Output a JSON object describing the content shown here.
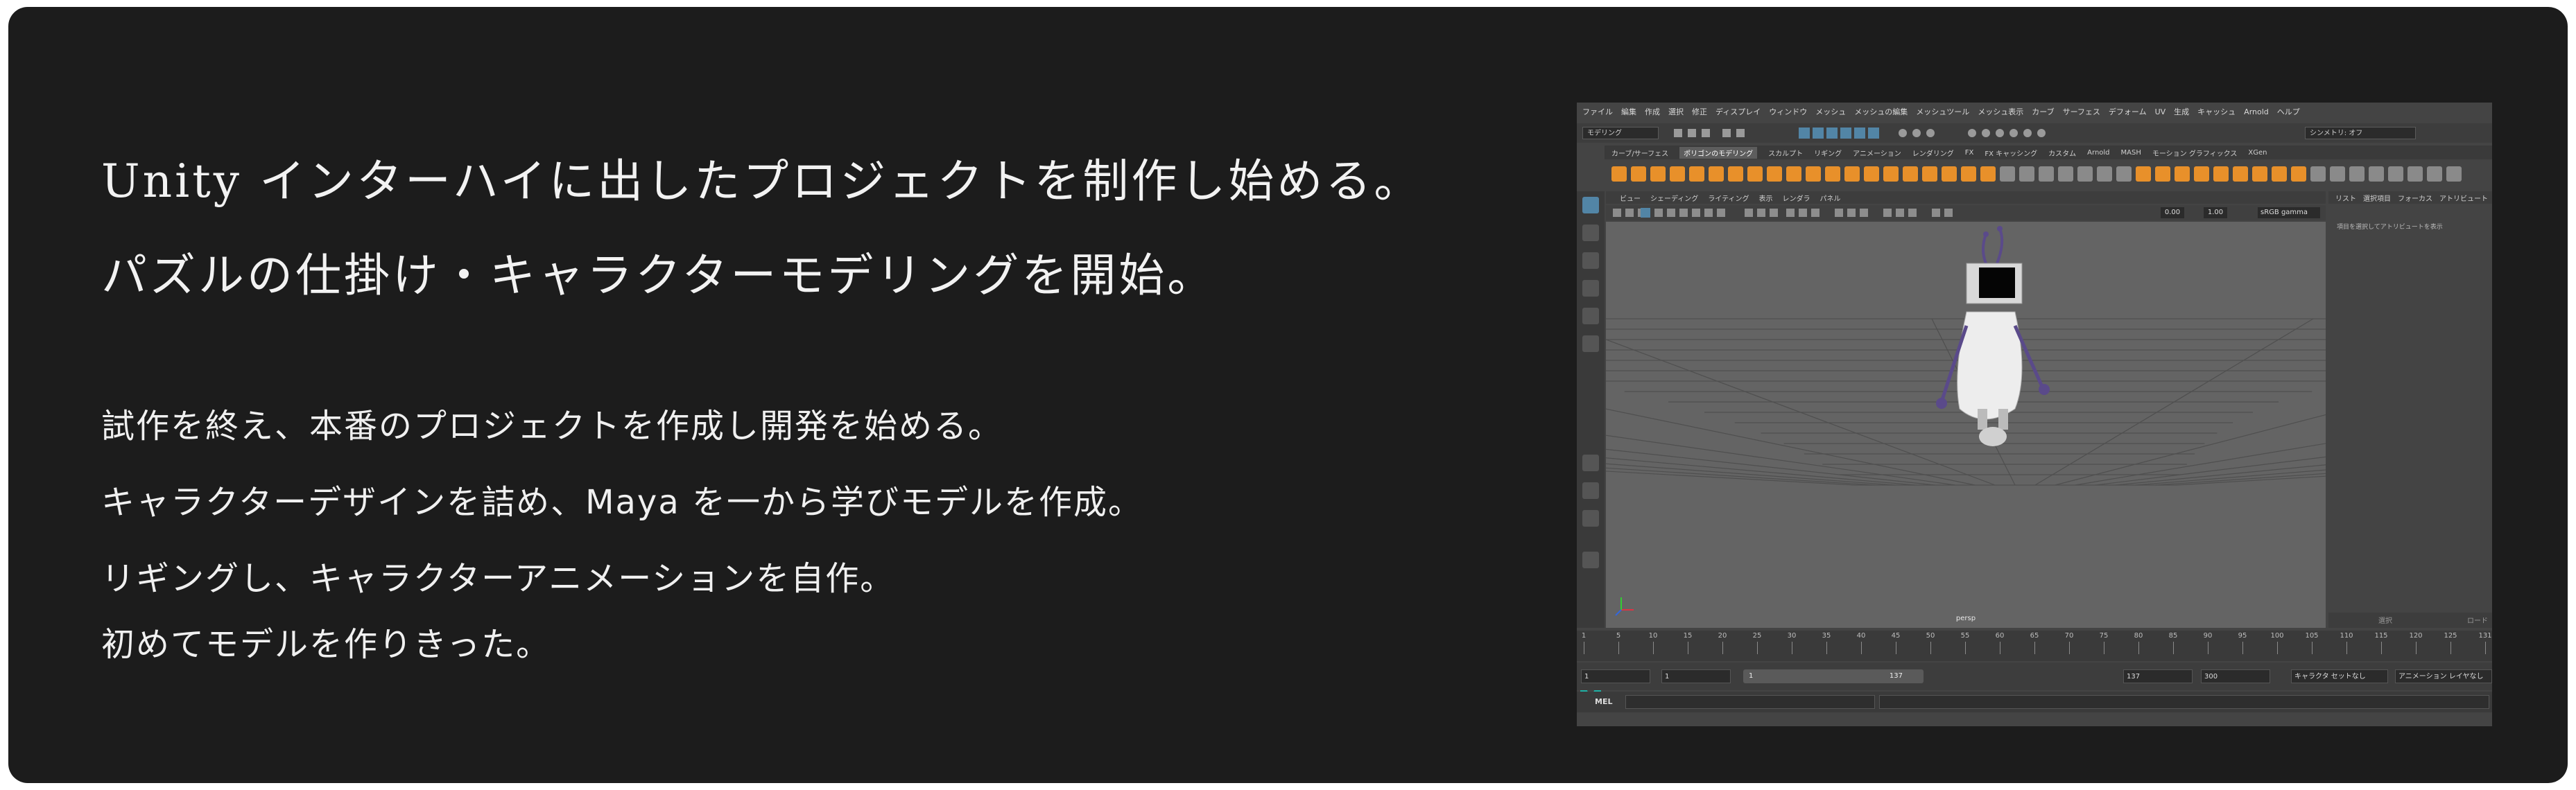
{
  "headline": {
    "line1": "Unity インターハイに出したプロジェクトを制作し始める。",
    "line2": "パズルの仕掛け・キャラクターモデリングを開始。"
  },
  "body": {
    "line1": "試作を終え、本番のプロジェクトを作成し開発を始める。",
    "line2": "キャラクターデザインを詰め、Maya を一から学びモデルを作成。",
    "line3": "リギングし、キャラクターアニメーションを自作。",
    "line4": "初めてモデルを作りきった。"
  },
  "maya": {
    "menu": [
      "ファイル",
      "編集",
      "作成",
      "選択",
      "修正",
      "ディスプレイ",
      "ウィンドウ",
      "メッシュ",
      "メッシュの編集",
      "メッシュツール",
      "メッシュ表示",
      "カーブ",
      "サーフェス",
      "デフォーム",
      "UV",
      "生成",
      "キャッシュ",
      "Arnold",
      "ヘルプ"
    ],
    "mode_select": "モデリング",
    "symmetry": "シンメトリ: オフ",
    "shelf_tabs": [
      "カーブ/サーフェス",
      "ポリゴンのモデリング",
      "スカルプト",
      "リギング",
      "アニメーション",
      "レンダリング",
      "FX",
      "FX キャッシング",
      "カスタム",
      "Arnold",
      "MASH",
      "モーション グラフィックス",
      "XGen"
    ],
    "active_shelf_tab": "ポリゴンのモデリング",
    "panel_menu": [
      "ビュー",
      "シェーディング",
      "ライティング",
      "表示",
      "レンダラ",
      "パネル"
    ],
    "gamma": "sRGB gamma",
    "exposure": "0.00",
    "gamma_value": "1.00",
    "camera_label": "persp",
    "attr_tabs": [
      "リスト",
      "選択項目",
      "フォーカス",
      "アトリビュート"
    ],
    "attr_message": "項目を選択してアトリビュートを表示",
    "attr_button_left": "選択",
    "attr_button_right": "ロード",
    "timeline_ticks": [
      "1",
      "5",
      "10",
      "15",
      "20",
      "25",
      "30",
      "35",
      "40",
      "45",
      "50",
      "55",
      "60",
      "65",
      "70",
      "75",
      "80",
      "85",
      "90",
      "95",
      "100",
      "105",
      "110",
      "115",
      "120",
      "125",
      "131"
    ],
    "range_start": "1",
    "range_start_inner": "1",
    "slider_start": "1",
    "slider_end": "137",
    "range_end_inner": "137",
    "range_end": "300",
    "char_set": "キャラクタ セットなし",
    "anim_layer": "アニメーション レイヤなし",
    "cmd_label": "MEL",
    "colors": {
      "shelf_orange": "#e8902a",
      "selected_blue": "#5285a6",
      "maya_teal": "#1fb2a6"
    }
  }
}
